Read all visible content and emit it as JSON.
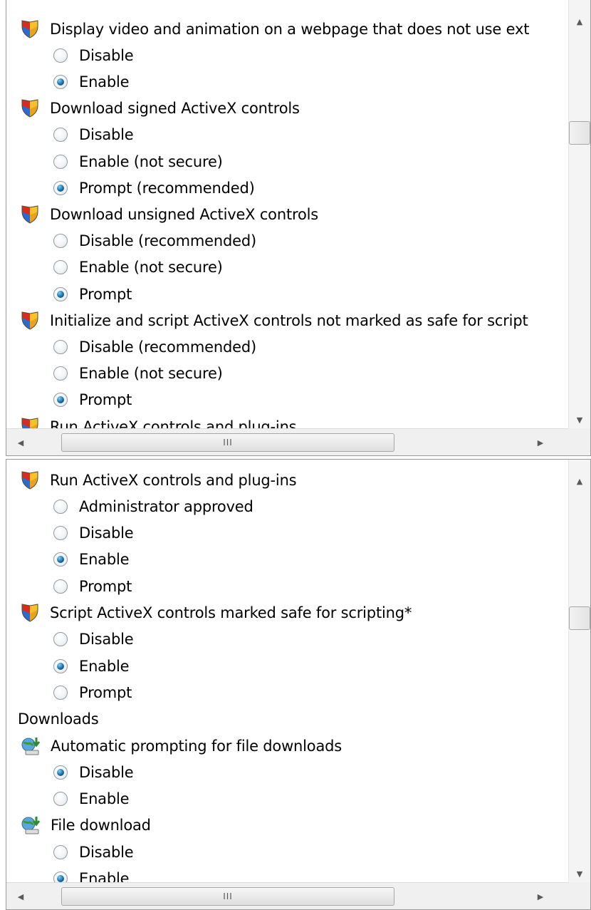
{
  "top_pane": {
    "rows": [
      {
        "kind": "setting",
        "label": "Display video and animation on a webpage that does not use ext"
      },
      {
        "kind": "option",
        "label": "Disable",
        "checked": false
      },
      {
        "kind": "option",
        "label": "Enable",
        "checked": true
      },
      {
        "kind": "setting",
        "label": "Download signed ActiveX controls"
      },
      {
        "kind": "option",
        "label": "Disable",
        "checked": false
      },
      {
        "kind": "option",
        "label": "Enable (not secure)",
        "checked": false
      },
      {
        "kind": "option",
        "label": "Prompt (recommended)",
        "checked": true
      },
      {
        "kind": "setting",
        "label": "Download unsigned ActiveX controls"
      },
      {
        "kind": "option",
        "label": "Disable (recommended)",
        "checked": false
      },
      {
        "kind": "option",
        "label": "Enable (not secure)",
        "checked": false
      },
      {
        "kind": "option",
        "label": "Prompt",
        "checked": true
      },
      {
        "kind": "setting",
        "label": "Initialize and script ActiveX controls not marked as safe for script"
      },
      {
        "kind": "option",
        "label": "Disable (recommended)",
        "checked": false
      },
      {
        "kind": "option",
        "label": "Enable (not secure)",
        "checked": false
      },
      {
        "kind": "option",
        "label": "Prompt",
        "checked": true
      },
      {
        "kind": "setting",
        "label": "Run ActiveX controls and plug-ins"
      }
    ],
    "hscroll_grip": "III"
  },
  "bottom_pane": {
    "rows": [
      {
        "kind": "setting",
        "label": "Run ActiveX controls and plug-ins"
      },
      {
        "kind": "option",
        "label": "Administrator approved",
        "checked": false
      },
      {
        "kind": "option",
        "label": "Disable",
        "checked": false
      },
      {
        "kind": "option",
        "label": "Enable",
        "checked": true
      },
      {
        "kind": "option",
        "label": "Prompt",
        "checked": false
      },
      {
        "kind": "setting",
        "label": "Script ActiveX controls marked safe for scripting*"
      },
      {
        "kind": "option",
        "label": "Disable",
        "checked": false
      },
      {
        "kind": "option",
        "label": "Enable",
        "checked": true
      },
      {
        "kind": "option",
        "label": "Prompt",
        "checked": false
      },
      {
        "kind": "group",
        "label": "Downloads"
      },
      {
        "kind": "download-setting",
        "label": "Automatic prompting for file downloads"
      },
      {
        "kind": "option",
        "label": "Disable",
        "checked": true
      },
      {
        "kind": "option",
        "label": "Enable",
        "checked": false
      },
      {
        "kind": "download-setting",
        "label": "File download"
      },
      {
        "kind": "option",
        "label": "Disable",
        "checked": false
      },
      {
        "kind": "option",
        "label": "Enable",
        "checked": true
      }
    ],
    "hscroll_grip": "III"
  },
  "icons": {
    "setting": "security-shield-icon",
    "download-setting": "download-globe-icon"
  }
}
